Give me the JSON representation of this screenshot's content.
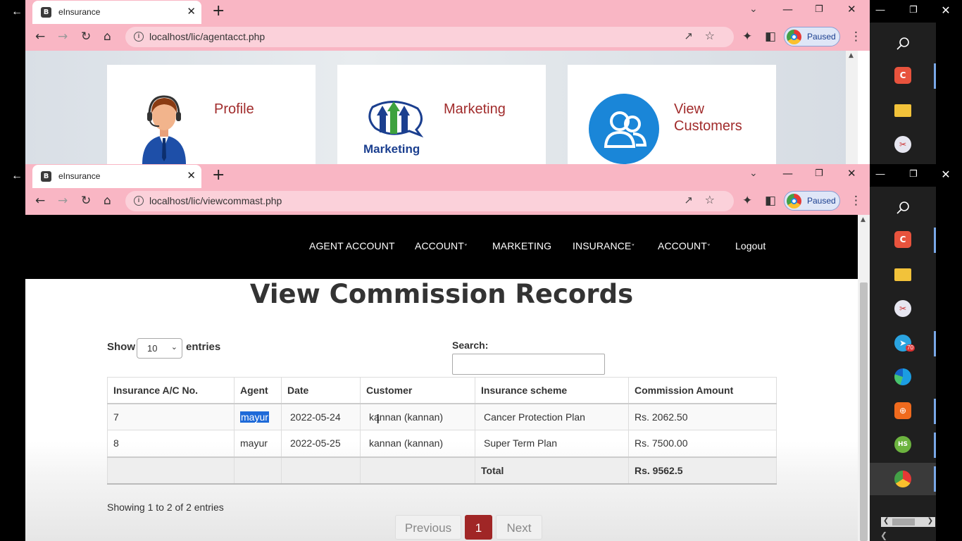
{
  "window1": {
    "tab_title": "eInsurance",
    "url": "localhost/lic/agentacct.php",
    "profile_status": "Paused",
    "cards": [
      {
        "label": "Profile",
        "icon": "agent-headset-icon"
      },
      {
        "label": "Marketing",
        "icon": "marketing-logo-icon",
        "logo_text": "Marketing"
      },
      {
        "label": "View Customers",
        "icon": "customers-icon"
      }
    ]
  },
  "window2": {
    "tab_title": "eInsurance",
    "url": "localhost/lic/viewcommast.php",
    "profile_status": "Paused",
    "nav": [
      "AGENT ACCOUNT",
      "ACCOUNT",
      "MARKETING",
      "INSURANCE",
      "ACCOUNT",
      "Logout"
    ],
    "page_title": "View Commission Records",
    "length": {
      "show": "Show",
      "selected": "10",
      "entries": "entries"
    },
    "search": {
      "label": "Search:",
      "value": ""
    },
    "table": {
      "headers": [
        "Insurance A/C No.",
        "Agent",
        "Date",
        "Customer",
        "Insurance scheme",
        "Commission Amount"
      ],
      "rows": [
        [
          "7",
          "mayur",
          "2022-05-24",
          "kannan (kannan)",
          "Cancer Protection Plan",
          "Rs. 2062.50"
        ],
        [
          "8",
          "mayur",
          "2022-05-25",
          "kannan (kannan)",
          "Super Term Plan",
          "Rs. 7500.00"
        ]
      ],
      "total_label": "Total",
      "total_value": "Rs. 9562.5"
    },
    "info": "Showing 1 to 2 of 2 entries",
    "pagination": {
      "previous": "Previous",
      "current": "1",
      "next": "Next"
    }
  },
  "taskbar": {
    "icons": [
      "search-icon",
      "app-c-icon",
      "file-explorer-icon",
      "snipping-tool-icon",
      "telegram-icon",
      "edge-icon",
      "app-box-icon",
      "hubstaff-icon",
      "chrome-icon"
    ],
    "telegram_badge": "70"
  },
  "colors": {
    "chrome_pink": "#f9b6c4",
    "card_label": "#a12c2c",
    "current_page": "#a02626",
    "selection": "#1e6ad8"
  }
}
